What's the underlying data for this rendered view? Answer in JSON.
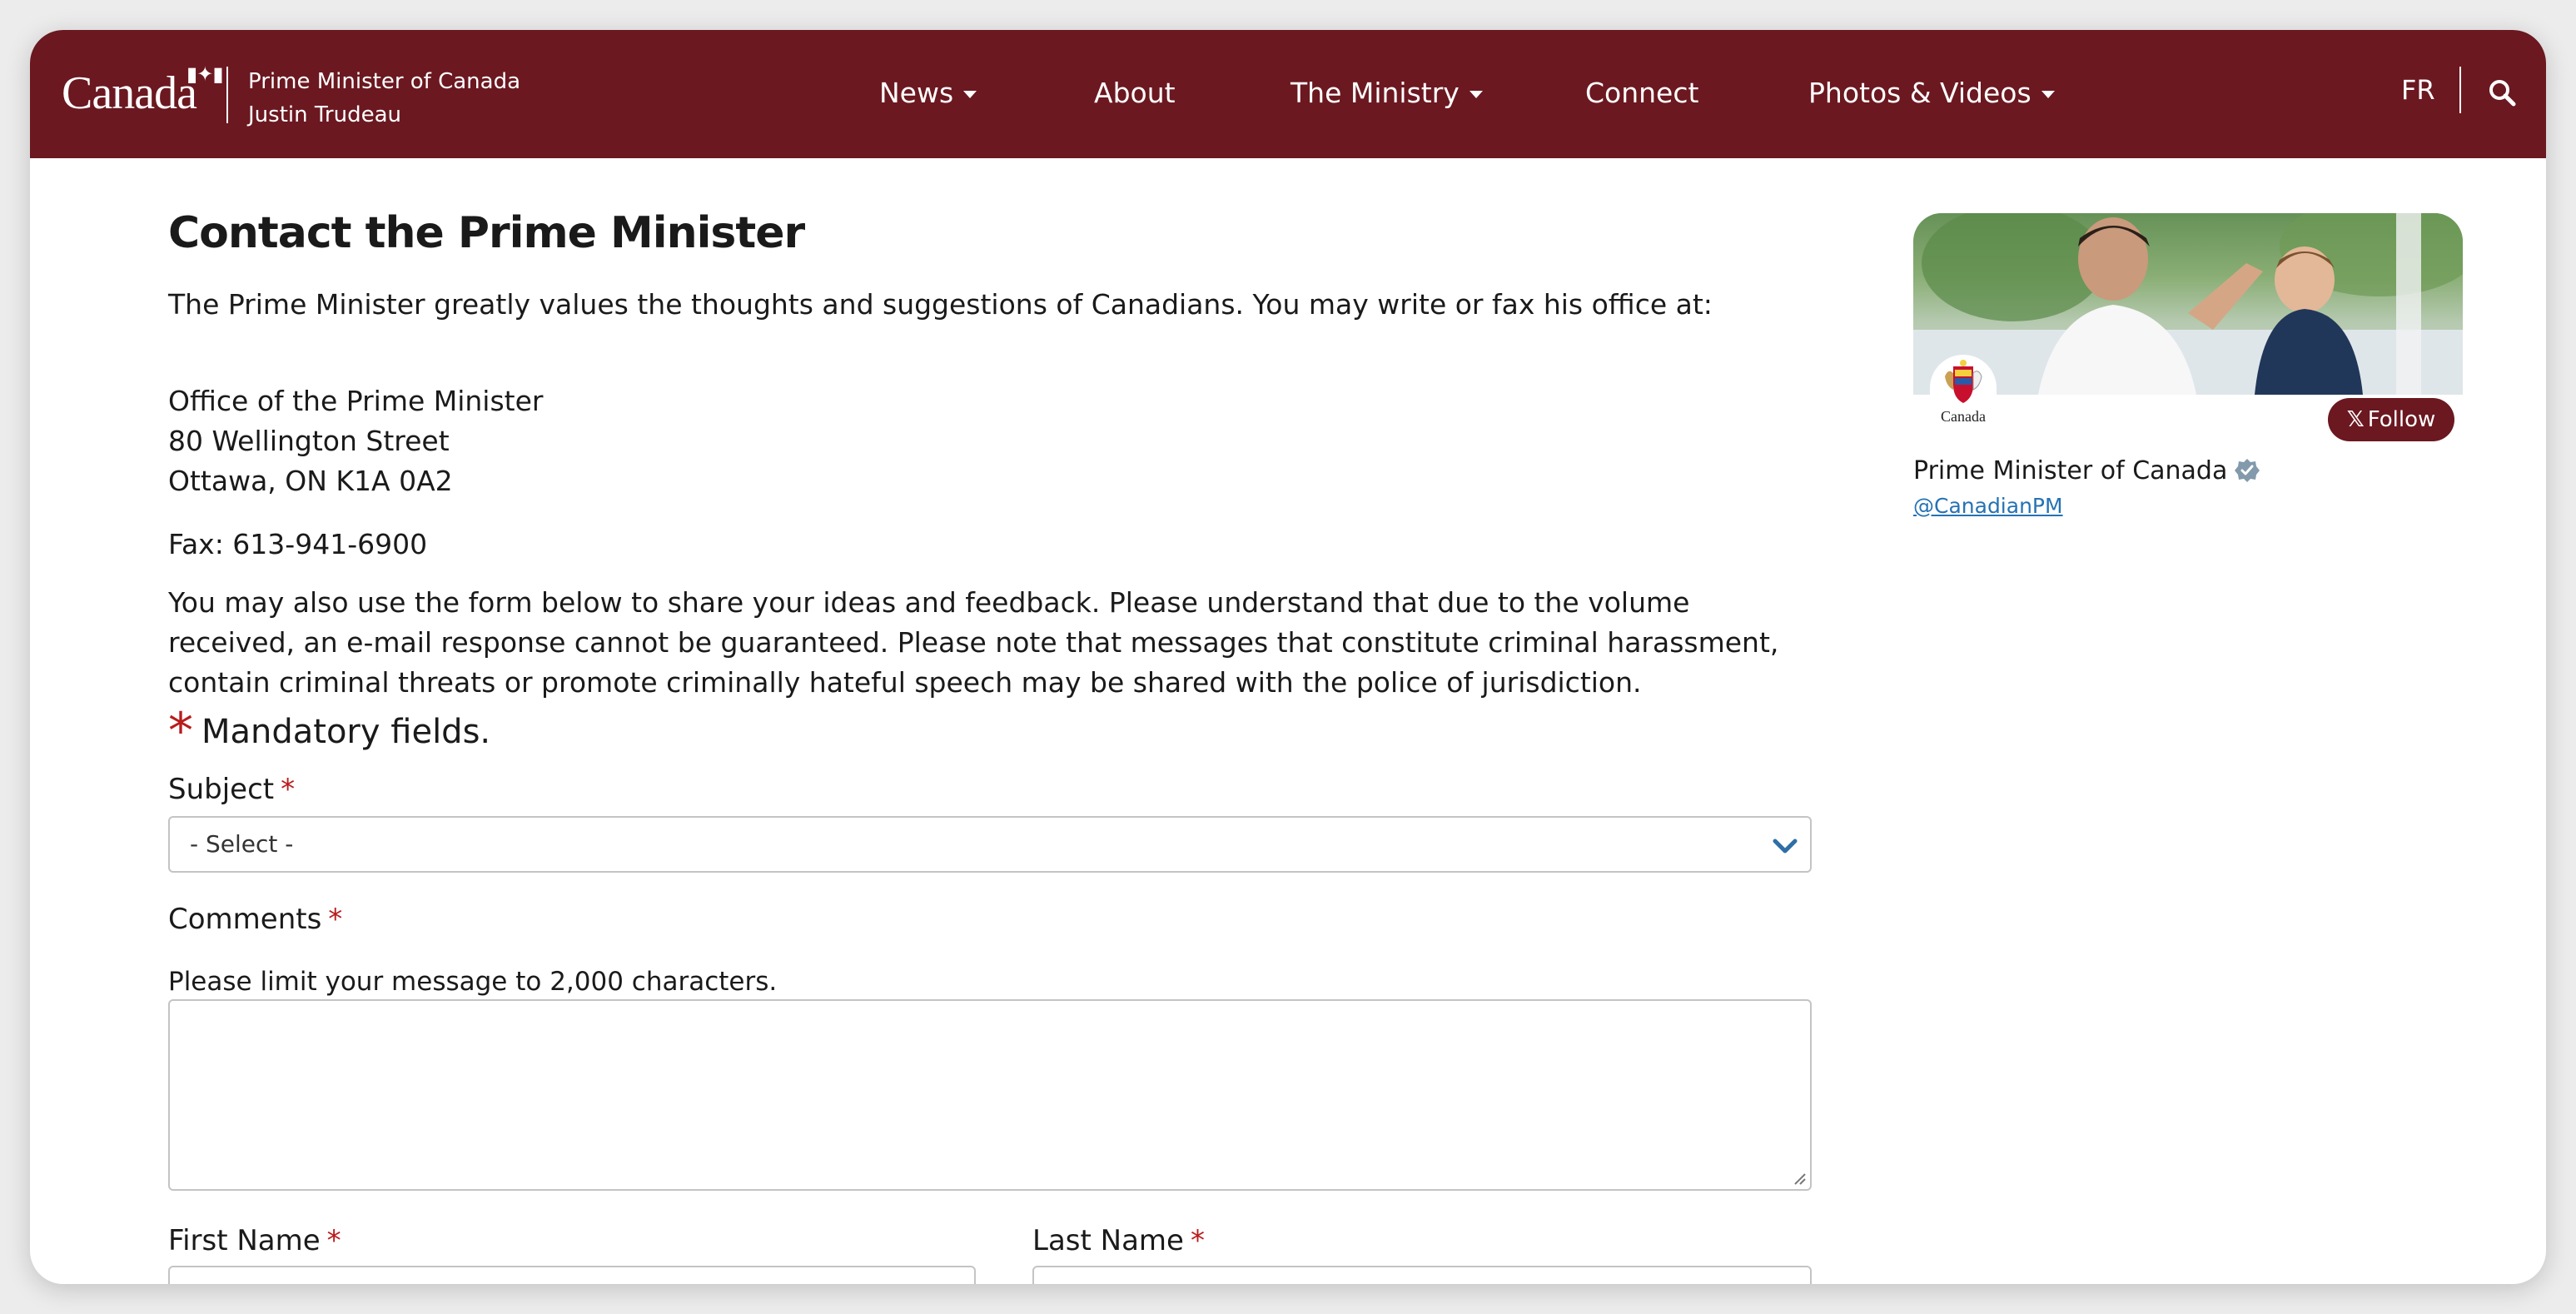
{
  "header": {
    "wordmark": "Canada",
    "brand_line1": "Prime Minister of Canada",
    "brand_line2": "Justin Trudeau",
    "nav": [
      {
        "label": "News",
        "dropdown": true
      },
      {
        "label": "About",
        "dropdown": false
      },
      {
        "label": "The Ministry",
        "dropdown": true
      },
      {
        "label": "Connect",
        "dropdown": false
      },
      {
        "label": "Photos & Videos",
        "dropdown": true
      }
    ],
    "lang_toggle": "FR",
    "search_icon": "search-icon",
    "bg_color": "#6b1820"
  },
  "main": {
    "title": "Contact the Prime Minister",
    "intro": "The Prime Minister greatly values the thoughts and suggestions of Canadians. You may write or fax his office at:",
    "address": {
      "line1": "Office of the Prime Minister",
      "line2": "80 Wellington Street",
      "line3": "Ottawa, ON K1A 0A2"
    },
    "fax": "Fax: 613-941-6900",
    "notice": "You may also use the form below to share your ideas and feedback. Please understand that due to the volume received, an e-mail response cannot be guaranteed. Please note that messages that constitute criminal harassment, contain criminal threats or promote criminally hateful speech may be shared with the police of jurisdiction.",
    "mandatory_note": "Mandatory fields.",
    "required_marker": "*",
    "form": {
      "subject_label": "Subject",
      "subject_value": "- Select -",
      "comments_label": "Comments",
      "comments_helper": "Please limit your message to 2,000 characters.",
      "comments_value": "",
      "first_name_label": "First Name",
      "last_name_label": "Last Name"
    },
    "required_color": "#b91c1c"
  },
  "sidebar": {
    "avatar_caption": "Canada",
    "follow_label": "Follow",
    "account_name": "Prime Minister of Canada",
    "handle": "@CanadianPM",
    "verified_icon": "verified-badge-icon"
  }
}
